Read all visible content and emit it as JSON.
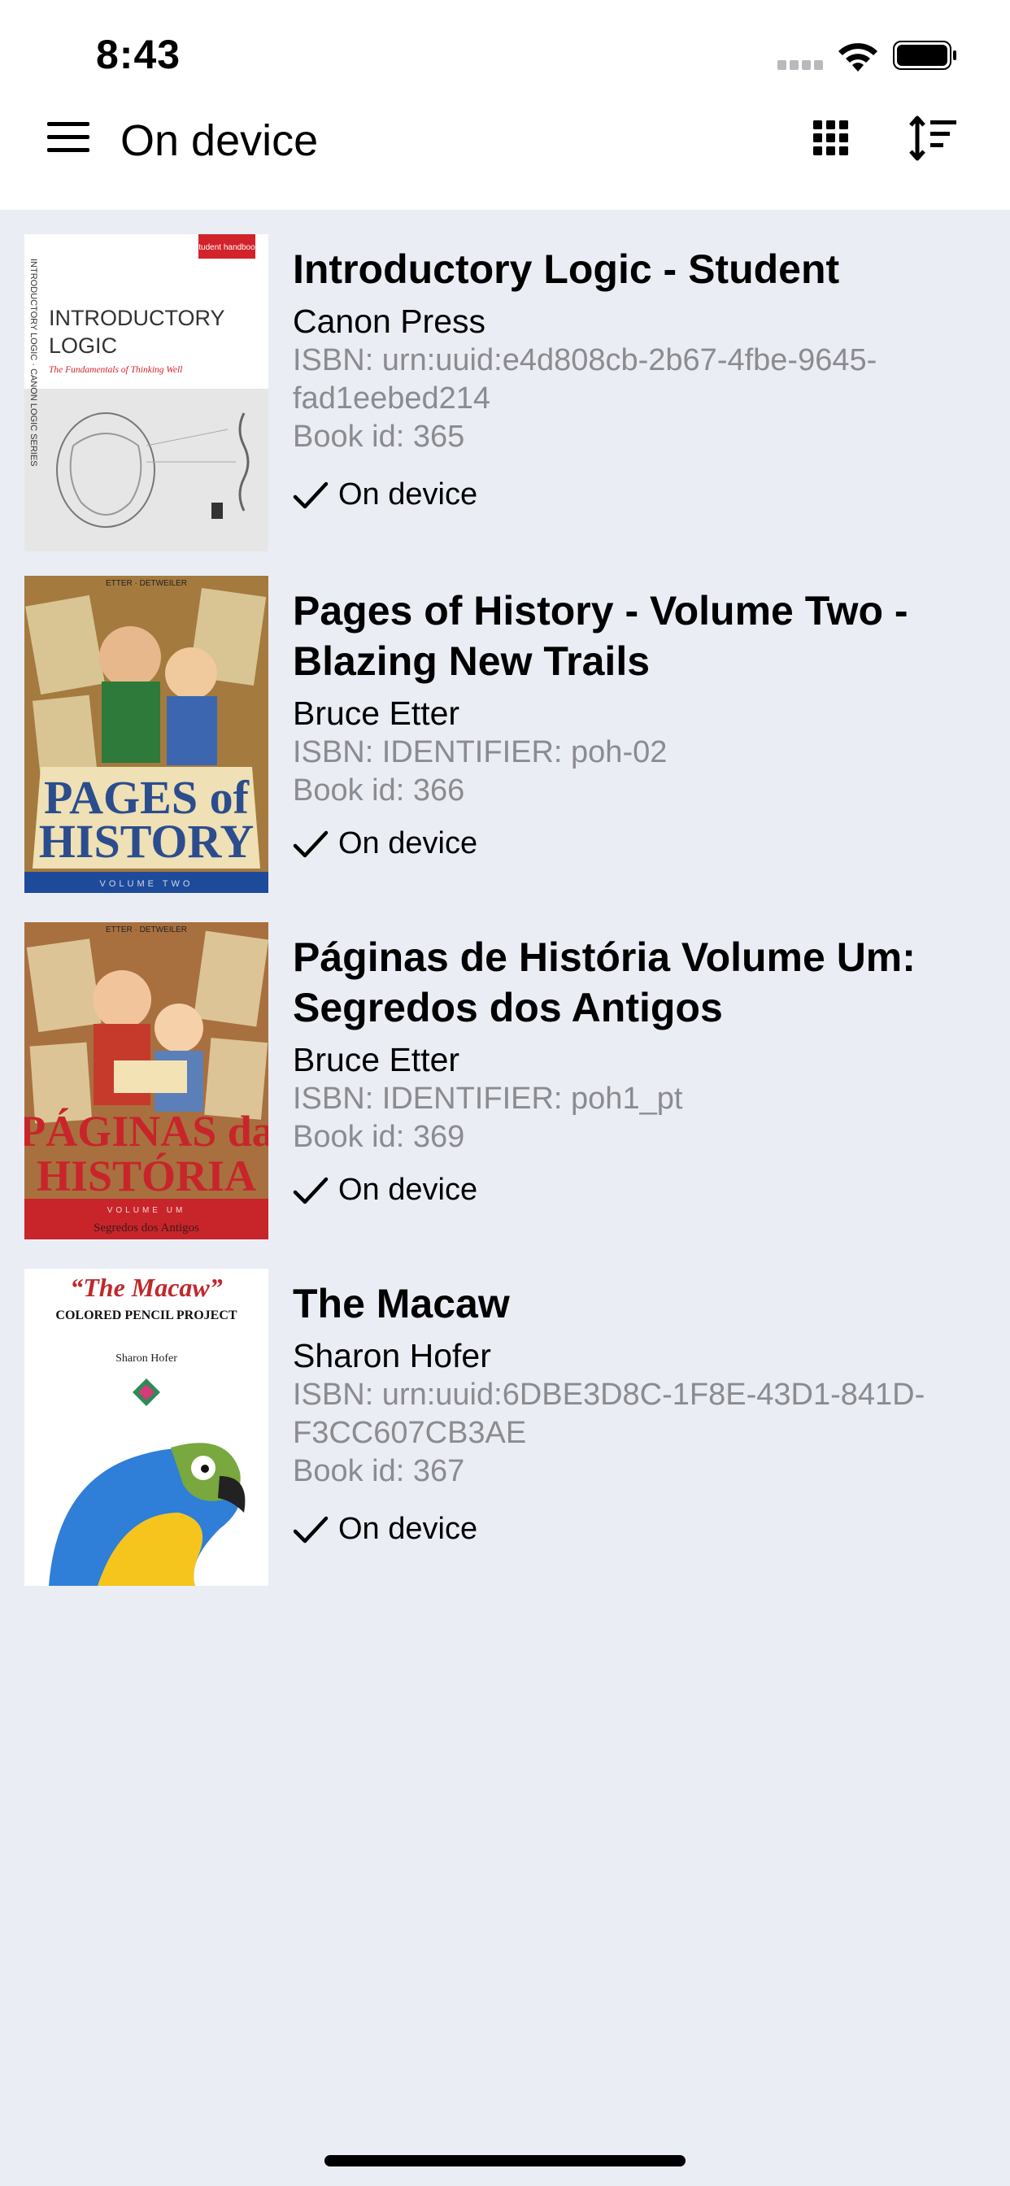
{
  "status": {
    "time": "8:43"
  },
  "header": {
    "title": "On device",
    "menu_icon": "hamburger-menu-icon",
    "grid_icon": "grid-view-icon",
    "sort_icon": "sort-icon"
  },
  "books": [
    {
      "title": "Introductory Logic - Student",
      "author": "Canon Press",
      "isbn": "ISBN: urn:uuid:e4d808cb-2b67-4fbe-9645-fad1eebed214",
      "book_id": "Book id: 365",
      "status": "On device",
      "cover": {
        "badge": "student handbook",
        "title": "INTRODUCTORY LOGIC",
        "subtitle": "The Fundamentals of Thinking Well",
        "spine": "INTRODUCTORY LOGIC · CANON LOGIC SERIES",
        "colors": {
          "bg": "#ffffff",
          "accent": "#d3232a"
        }
      }
    },
    {
      "title": "Pages of History - Volume Two - Blazing New Trails",
      "author": "Bruce Etter",
      "isbn": "ISBN: IDENTIFIER: poh-02",
      "book_id": "Book id: 366",
      "status": "On device",
      "cover": {
        "top": "ETTER · DETWEILER",
        "title_line1": "PAGES of",
        "title_line2": "HISTORY",
        "band": "VOLUME TWO",
        "colors": {
          "bg": "#a47a3e",
          "title": "#2b4d8e",
          "band": "#1e4a9a"
        }
      }
    },
    {
      "title": "Páginas de História Volume Um: Segredos dos Antigos",
      "author": "Bruce Etter",
      "isbn": "ISBN: IDENTIFIER: poh1_pt",
      "book_id": "Book id: 369",
      "status": "On device",
      "cover": {
        "top": "ETTER · DETWEILER",
        "title_line1": "PÁGINAS da",
        "title_line2": "HISTÓRIA",
        "band": "VOLUME UM",
        "footer": "Segredos dos Antigos",
        "colors": {
          "bg": "#a8703e",
          "title": "#c8252a",
          "band": "#c8252a"
        }
      }
    },
    {
      "title": "The Macaw",
      "author": "Sharon Hofer",
      "isbn": "ISBN: urn:uuid:6DBE3D8C-1F8E-43D1-841D-F3CC607CB3AE",
      "book_id": "Book id: 367",
      "status": "On device",
      "cover": {
        "title": "“The Macaw”",
        "subtitle": "COLORED PENCIL PROJECT",
        "author": "Sharon Hofer",
        "colors": {
          "title": "#c0282d",
          "bird_blue": "#2f7ed8",
          "bird_yellow": "#f5c51e"
        }
      }
    }
  ]
}
